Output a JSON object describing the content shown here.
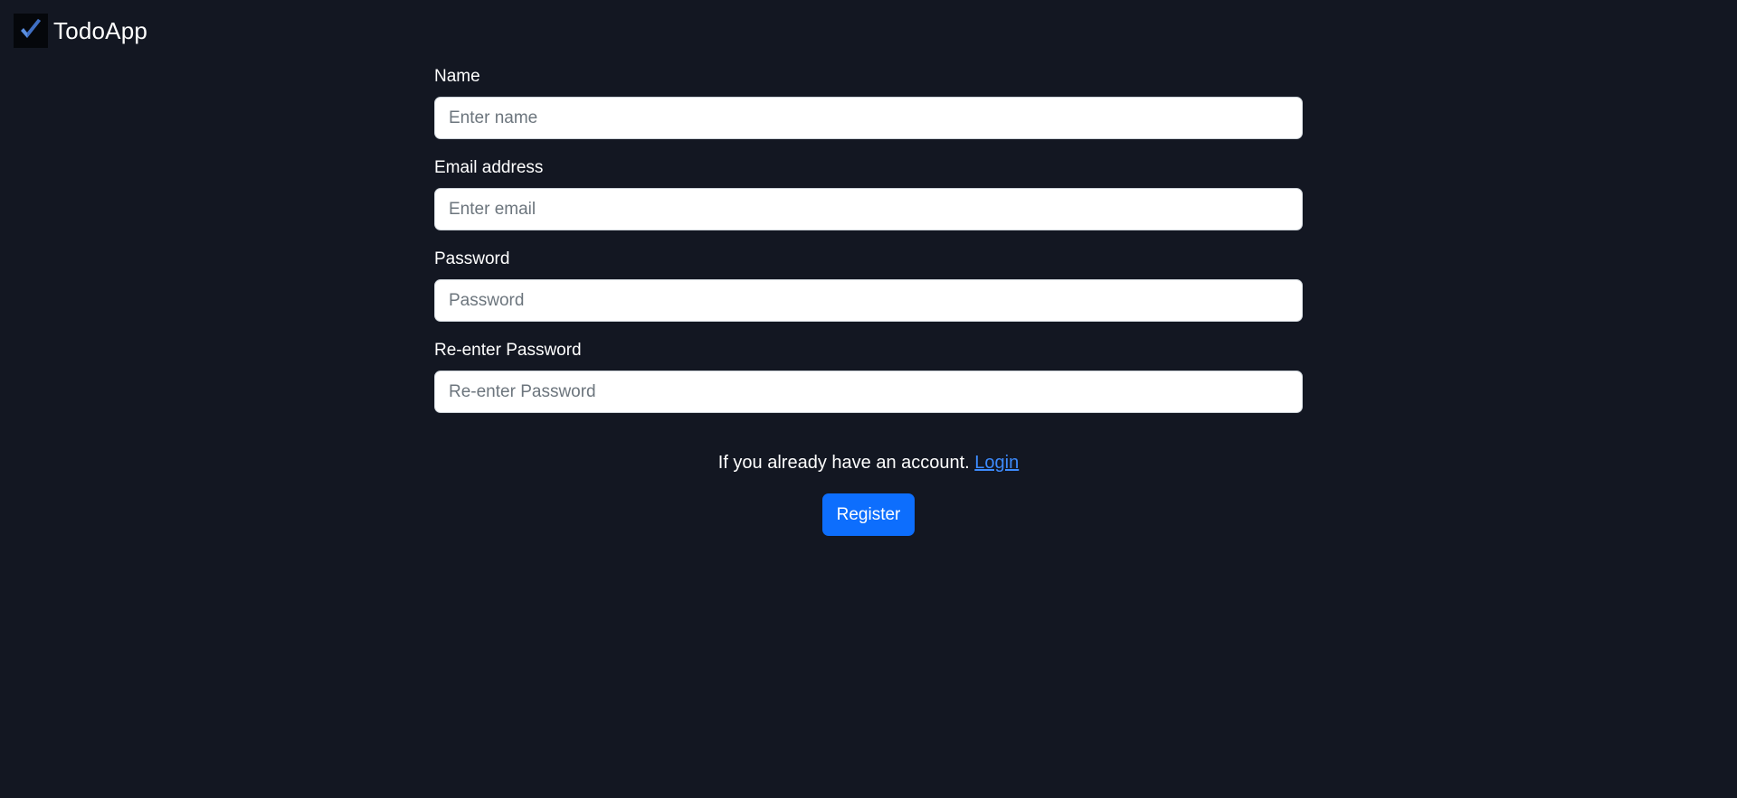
{
  "app": {
    "brand_name": "TodoApp",
    "logo_icon": "checkmark-icon",
    "accent_color": "#0d6efd",
    "background_color": "#131722"
  },
  "form": {
    "fields": [
      {
        "label": "Name",
        "placeholder": "Enter name",
        "value": ""
      },
      {
        "label": "Email address",
        "placeholder": "Enter email",
        "value": ""
      },
      {
        "label": "Password",
        "placeholder": "Password",
        "value": ""
      },
      {
        "label": "Re-enter Password",
        "placeholder": "Re-enter Password",
        "value": ""
      }
    ],
    "login_prompt": "If you already have an account.",
    "login_link": "Login",
    "submit_label": "Register"
  }
}
